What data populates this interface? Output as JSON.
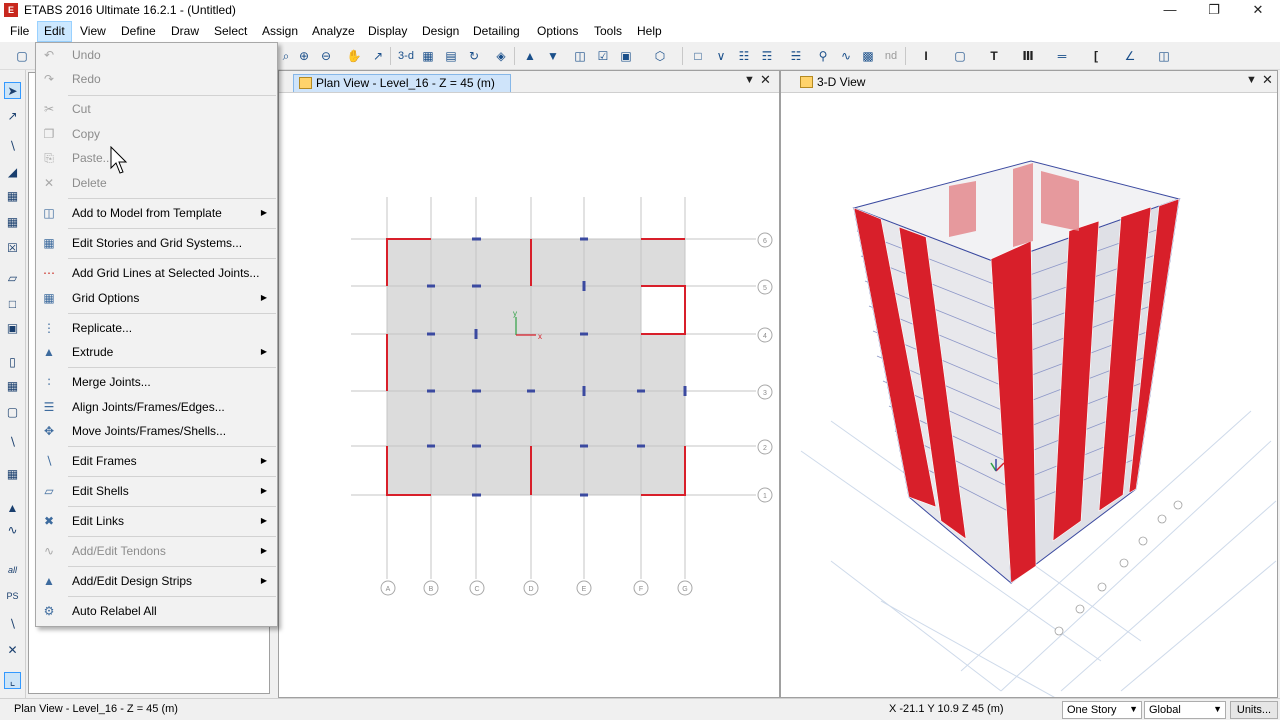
{
  "window": {
    "title": "ETABS 2016 Ultimate 16.2.1 - (Untitled)",
    "app_icon_letter": "E"
  },
  "menubar": [
    "File",
    "Edit",
    "View",
    "Define",
    "Draw",
    "Select",
    "Assign",
    "Analyze",
    "Display",
    "Design",
    "Detailing",
    "Options",
    "Tools",
    "Help"
  ],
  "toolbar": {
    "text_3d": "3-d",
    "text_nd": "nd"
  },
  "left_toolbar": {
    "label_all": "all",
    "label_ps": "PS"
  },
  "views": {
    "plan": {
      "title": "Plan View - Level_16 - Z = 45 (m)"
    },
    "three_d": {
      "title": "3-D View"
    }
  },
  "plan_grid": {
    "column_bubbles": [
      "A",
      "B",
      "C",
      "D",
      "E",
      "F",
      "G"
    ],
    "row_bubbles": [
      "6",
      "5",
      "4",
      "3",
      "2",
      "1"
    ],
    "axis_x": "x",
    "axis_y": "y"
  },
  "edit_menu": {
    "items": [
      {
        "label": "Undo",
        "icon": "undo-icon",
        "disabled": true,
        "submenu": false
      },
      {
        "label": "Redo",
        "icon": "redo-icon",
        "disabled": true,
        "submenu": false
      },
      {
        "label": "Cut",
        "icon": "cut-icon",
        "disabled": true,
        "submenu": false
      },
      {
        "label": "Copy",
        "icon": "copy-icon",
        "disabled": true,
        "submenu": false
      },
      {
        "label": "Paste...",
        "icon": "paste-icon",
        "disabled": true,
        "submenu": false
      },
      {
        "label": "Delete",
        "icon": "delete-icon",
        "disabled": true,
        "submenu": false
      },
      {
        "label": "Add to Model from Template",
        "icon": "template-icon",
        "disabled": false,
        "submenu": true
      },
      {
        "label": "Edit Stories and Grid Systems...",
        "icon": "stories-icon",
        "disabled": false,
        "submenu": false
      },
      {
        "label": "Add Grid Lines at Selected Joints...",
        "icon": "grid-lines-icon",
        "disabled": false,
        "submenu": false
      },
      {
        "label": "Grid Options",
        "icon": "grid-options-icon",
        "disabled": false,
        "submenu": true
      },
      {
        "label": "Replicate...",
        "icon": "replicate-icon",
        "disabled": false,
        "submenu": false
      },
      {
        "label": "Extrude",
        "icon": "extrude-icon",
        "disabled": false,
        "submenu": true
      },
      {
        "label": "Merge Joints...",
        "icon": "merge-icon",
        "disabled": false,
        "submenu": false
      },
      {
        "label": "Align Joints/Frames/Edges...",
        "icon": "align-icon",
        "disabled": false,
        "submenu": false
      },
      {
        "label": "Move Joints/Frames/Shells...",
        "icon": "move-icon",
        "disabled": false,
        "submenu": false
      },
      {
        "label": "Edit Frames",
        "icon": "frames-icon",
        "disabled": false,
        "submenu": true
      },
      {
        "label": "Edit Shells",
        "icon": "shells-icon",
        "disabled": false,
        "submenu": true
      },
      {
        "label": "Edit Links",
        "icon": "links-icon",
        "disabled": false,
        "submenu": true
      },
      {
        "label": "Add/Edit Tendons",
        "icon": "tendons-icon",
        "disabled": true,
        "submenu": true
      },
      {
        "label": "Add/Edit Design Strips",
        "icon": "strips-icon",
        "disabled": false,
        "submenu": true
      },
      {
        "label": "Auto Relabel All",
        "icon": "relabel-icon",
        "disabled": false,
        "submenu": false
      }
    ]
  },
  "statusbar": {
    "left": "Plan View - Level_16 - Z = 45 (m)",
    "coords": "X -21.1  Y 10.9  Z 45 (m)",
    "story_select": "One Story",
    "coord_select": "Global",
    "units_button": "Units..."
  },
  "colors": {
    "accent": "#cce8ff",
    "wall_red": "#d81f2a",
    "grid_blue": "#3b4aa0"
  }
}
